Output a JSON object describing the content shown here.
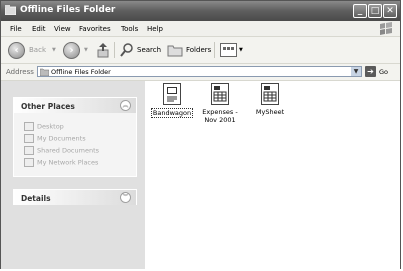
{
  "window": {
    "title": "Offline Files Folder"
  },
  "menu": [
    "File",
    "Edit",
    "View",
    "Favorites",
    "Tools",
    "Help"
  ],
  "toolbar": {
    "back": "Back",
    "search": "Search",
    "folders": "Folders"
  },
  "address": {
    "label": "Address",
    "value": "Offline Files Folder",
    "go": "Go"
  },
  "other_places": {
    "title": "Other Places",
    "items": [
      "Desktop",
      "My Documents",
      "Shared Documents",
      "My Network Places"
    ]
  },
  "details": {
    "title": "Details"
  },
  "files": [
    {
      "name": "Bandwagon",
      "icon": "document-icon",
      "selected": true
    },
    {
      "name": "Expenses - Nov 2001",
      "icon": "spreadsheet-icon",
      "selected": false
    },
    {
      "name": "MySheet",
      "icon": "spreadsheet-icon",
      "selected": false
    }
  ]
}
